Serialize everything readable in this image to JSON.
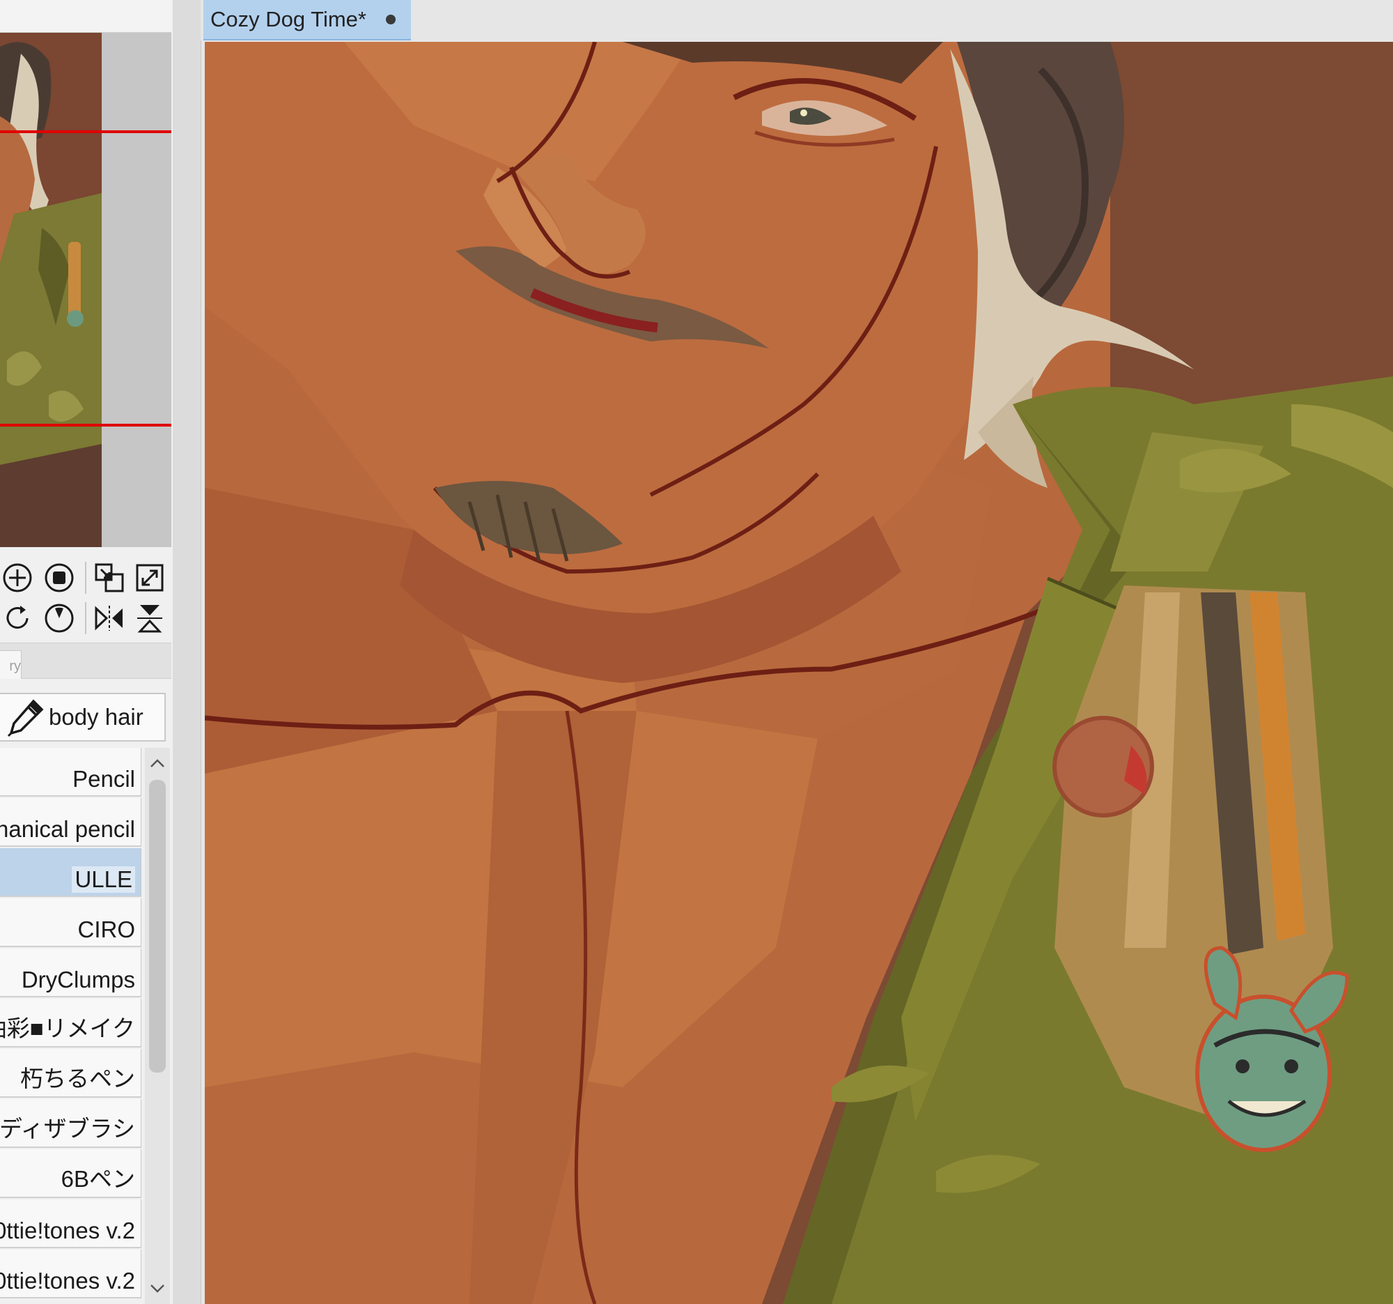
{
  "document": {
    "tab_title": "Cozy Dog Time*"
  },
  "tool_panel": {
    "tab_label": "ry"
  },
  "subtool": {
    "current": "body hair",
    "brushes": [
      "Pencil",
      "hanical pencil",
      "ULLE",
      "CIRO",
      "DryClumps",
      "油彩■リメイク",
      "朽ちるペン",
      "ディザブラシ",
      "6Bペン",
      "0ttie!tones v.2",
      "0ttie!tones v.2"
    ],
    "selected_index": 2
  },
  "colors": {
    "panel_bg": "#f0f0f0",
    "tab_active": "#b3d1ed",
    "selection": "#bcd3e9",
    "navigator_frame": "#e00000",
    "canvas_bg": "#7d4a34",
    "skin": "#b8683d",
    "jacket": "#7a7a2e"
  },
  "icons": [
    "zoom-in-icon",
    "stop-icon",
    "fit-window-icon",
    "expand-icon",
    "rotate-icon",
    "rotation-dial-icon",
    "flip-horizontal-icon",
    "flip-vertical-icon",
    "pen-icon",
    "scroll-up-icon",
    "scroll-down-icon",
    "tab-close-icon"
  ]
}
